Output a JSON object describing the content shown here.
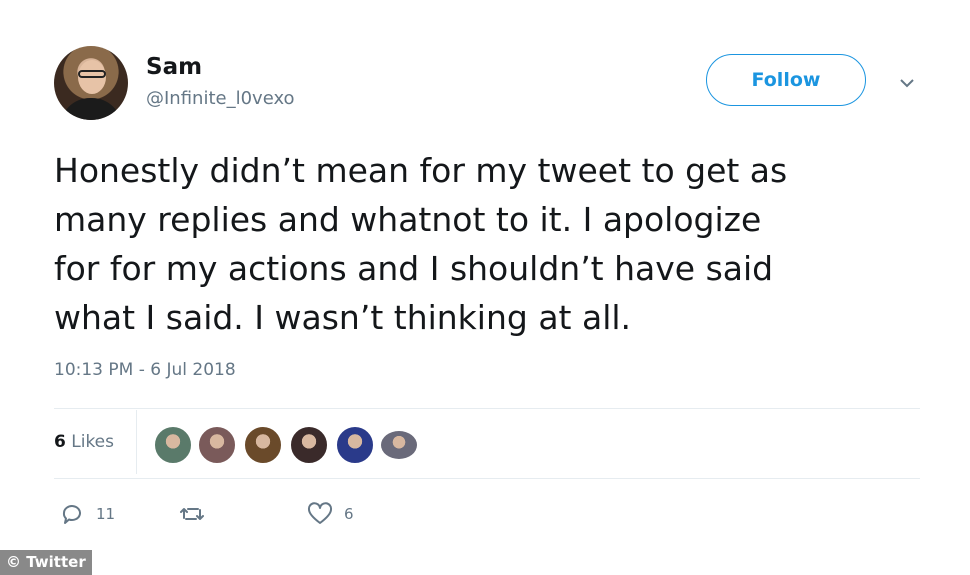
{
  "author": {
    "name": "Sam",
    "handle": "@Infinite_l0vexo"
  },
  "header": {
    "follow_label": "Follow",
    "menu_icon": "chevron-down-icon"
  },
  "tweet": {
    "lines": [
      "Honestly didn’t mean for my tweet to get as",
      "many replies and whatnot to it. I apologize",
      "for for my actions and I shouldn’t have said",
      "what I said. I wasn’t thinking at all."
    ],
    "timestamp": "10:13 PM - 6 Jul 2018"
  },
  "likes": {
    "count": "6",
    "label": "Likes",
    "avatar_colors": [
      "#5a7a6a",
      "#7a5a5a",
      "#6a4a2a",
      "#3a2a2a",
      "#2a3a8a",
      "#6a6a7a"
    ]
  },
  "actions": {
    "reply_count": "11",
    "retweet_count": "",
    "like_count": "6"
  },
  "watermark": "© Twitter",
  "colors": {
    "accent": "#1b95e0",
    "secondary_text": "#657786",
    "divider": "#e6ecf0"
  }
}
